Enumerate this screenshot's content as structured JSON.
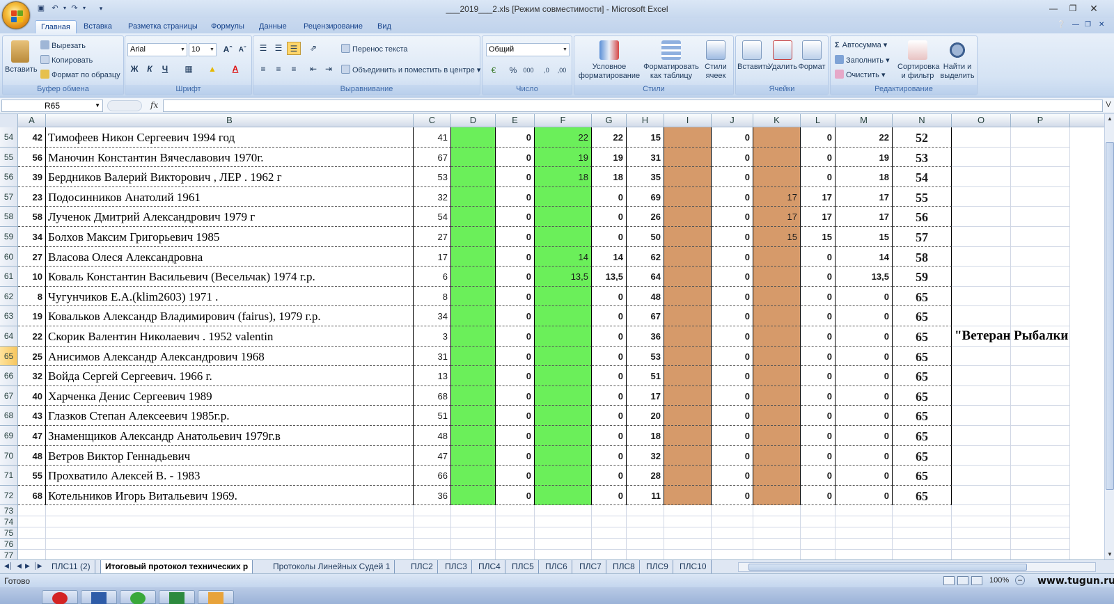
{
  "window": {
    "title": "___2019___2.xls  [Режим совместимости] - Microsoft Excel"
  },
  "tabs": [
    "Главная",
    "Вставка",
    "Разметка страницы",
    "Формулы",
    "Данные",
    "Рецензирование",
    "Вид"
  ],
  "ribbon": {
    "clipboard": {
      "paste": "Вставить",
      "cut": "Вырезать",
      "copy": "Копировать",
      "format_painter": "Формат по образцу",
      "label": "Буфер обмена"
    },
    "font": {
      "name": "Arial",
      "size": "10",
      "bold": "Ж",
      "italic": "К",
      "underline": "Ч",
      "label": "Шрифт"
    },
    "alignment": {
      "wrap": "Перенос текста",
      "merge": "Объединить и поместить в центре",
      "label": "Выравнивание"
    },
    "number": {
      "format": "Общий",
      "percent": "%",
      "thousands": "000",
      "label": "Число"
    },
    "styles": {
      "conditional": "Условное форматирование",
      "as_table": "Форматировать как таблицу",
      "cell_styles": "Стили ячеек",
      "label": "Стили"
    },
    "cells": {
      "insert": "Вставить",
      "delete": "Удалить",
      "format": "Формат",
      "label": "Ячейки"
    },
    "editing": {
      "autosum": "Автосумма",
      "fill": "Заполнить",
      "clear": "Очистить",
      "sort": "Сортировка и фильтр",
      "find": "Найти и выделить",
      "label": "Редактирование"
    }
  },
  "formula_bar": {
    "name_box": "R65",
    "fx": "fx",
    "value": ""
  },
  "columns": [
    "A",
    "B",
    "C",
    "D",
    "E",
    "F",
    "G",
    "H",
    "I",
    "J",
    "K",
    "L",
    "M",
    "N",
    "O",
    "P"
  ],
  "rows": [
    {
      "r": "54",
      "a": "42",
      "b": "Тимофеев Никон Сергеевич 1994 год",
      "c": "41",
      "e": "0",
      "f": "22",
      "g": "22",
      "h": "15",
      "j": "0",
      "k": "",
      "l": "0",
      "m": "22",
      "n": "52"
    },
    {
      "r": "55",
      "a": "56",
      "b": "Маночин Константин Вячеславович 1970г.",
      "c": "67",
      "e": "0",
      "f": "19",
      "g": "19",
      "h": "31",
      "j": "0",
      "k": "",
      "l": "0",
      "m": "19",
      "n": "53"
    },
    {
      "r": "56",
      "a": "39",
      "b": "Бердников Валерий Викторович , ЛЕР . 1962 г",
      "c": "53",
      "e": "0",
      "f": "18",
      "g": "18",
      "h": "35",
      "j": "0",
      "k": "",
      "l": "0",
      "m": "18",
      "n": "54"
    },
    {
      "r": "57",
      "a": "23",
      "b": "Подосинников Анатолий 1961",
      "c": "32",
      "e": "0",
      "f": "",
      "g": "0",
      "h": "69",
      "j": "0",
      "k": "17",
      "l": "17",
      "m": "17",
      "n": "55"
    },
    {
      "r": "58",
      "a": "58",
      "b": "Лученок Дмитрий Александрович 1979 г",
      "c": "54",
      "e": "0",
      "f": "",
      "g": "0",
      "h": "26",
      "j": "0",
      "k": "17",
      "l": "17",
      "m": "17",
      "n": "56"
    },
    {
      "r": "59",
      "a": "34",
      "b": "Болхов Максим Григорьевич 1985",
      "c": "27",
      "e": "0",
      "f": "",
      "g": "0",
      "h": "50",
      "j": "0",
      "k": "15",
      "l": "15",
      "m": "15",
      "n": "57"
    },
    {
      "r": "60",
      "a": "27",
      "b": "Власова Олеся Александровна",
      "c": "17",
      "e": "0",
      "f": "14",
      "g": "14",
      "h": "62",
      "j": "0",
      "k": "",
      "l": "0",
      "m": "14",
      "n": "58"
    },
    {
      "r": "61",
      "a": "10",
      "b": "Коваль Константин Васильевич (Весельчак) 1974 г.р.",
      "c": "6",
      "e": "0",
      "f": "13,5",
      "g": "13,5",
      "h": "64",
      "j": "0",
      "k": "",
      "l": "0",
      "m": "13,5",
      "n": "59"
    },
    {
      "r": "62",
      "a": "8",
      "b": "Чугунчиков Е.А.(klim2603) 1971 .",
      "c": "8",
      "e": "0",
      "f": "",
      "g": "0",
      "h": "48",
      "j": "0",
      "k": "",
      "l": "0",
      "m": "0",
      "n": "65"
    },
    {
      "r": "63",
      "a": "19",
      "b": "Ковальков Александр Владимирович (fairus), 1979 г.р.",
      "c": "34",
      "e": "0",
      "f": "",
      "g": "0",
      "h": "67",
      "j": "0",
      "k": "",
      "l": "0",
      "m": "0",
      "n": "65"
    },
    {
      "r": "64",
      "a": "22",
      "b": "Скорик Валентин Николаевич . 1952 valentin",
      "c": "3",
      "e": "0",
      "f": "",
      "g": "0",
      "h": "36",
      "j": "0",
      "k": "",
      "l": "0",
      "m": "0",
      "n": "65",
      "o": "\"Ветеран Рыбалки"
    },
    {
      "r": "65",
      "a": "25",
      "b": "Анисимов Александр Александрович 1968",
      "c": "31",
      "e": "0",
      "f": "",
      "g": "0",
      "h": "53",
      "j": "0",
      "k": "",
      "l": "0",
      "m": "0",
      "n": "65"
    },
    {
      "r": "66",
      "a": "32",
      "b": "Войда Сергей Сергеевич. 1966 г.",
      "c": "13",
      "e": "0",
      "f": "",
      "g": "0",
      "h": "51",
      "j": "0",
      "k": "",
      "l": "0",
      "m": "0",
      "n": "65"
    },
    {
      "r": "67",
      "a": "40",
      "b": "Харченка Денис Сергеевич 1989",
      "c": "68",
      "e": "0",
      "f": "",
      "g": "0",
      "h": "17",
      "j": "0",
      "k": "",
      "l": "0",
      "m": "0",
      "n": "65"
    },
    {
      "r": "68",
      "a": "43",
      "b": "Глазков Степан Алексеевич 1985г.р.",
      "c": "51",
      "e": "0",
      "f": "",
      "g": "0",
      "h": "20",
      "j": "0",
      "k": "",
      "l": "0",
      "m": "0",
      "n": "65"
    },
    {
      "r": "69",
      "a": "47",
      "b": "Знаменщиков Александр Анатольевич 1979г.в",
      "c": "48",
      "e": "0",
      "f": "",
      "g": "0",
      "h": "18",
      "j": "0",
      "k": "",
      "l": "0",
      "m": "0",
      "n": "65"
    },
    {
      "r": "70",
      "a": "48",
      "b": "Ветров Виктор Геннадьевич",
      "c": "47",
      "e": "0",
      "f": "",
      "g": "0",
      "h": "32",
      "j": "0",
      "k": "",
      "l": "0",
      "m": "0",
      "n": "65"
    },
    {
      "r": "71",
      "a": "55",
      "b": "Прохватило Алексей В. - 1983",
      "c": "66",
      "e": "0",
      "f": "",
      "g": "0",
      "h": "28",
      "j": "0",
      "k": "",
      "l": "0",
      "m": "0",
      "n": "65"
    },
    {
      "r": "72",
      "a": "68",
      "b": "Котельников Игорь Витальевич 1969.",
      "c": "36",
      "e": "0",
      "f": "",
      "g": "0",
      "h": "11",
      "j": "0",
      "k": "",
      "l": "0",
      "m": "0",
      "n": "65"
    }
  ],
  "empty_rows": [
    "73",
    "74",
    "75",
    "76",
    "77"
  ],
  "selected_row": "65",
  "sheet_tabs": [
    "ПЛС11 (2)",
    "Итоговый протокол технических р",
    "Протоколы Линейных Судей 1",
    "ПЛС2",
    "ПЛС3",
    "ПЛС4",
    "ПЛС5",
    "ПЛС6",
    "ПЛС7",
    "ПЛС8",
    "ПЛС9",
    "ПЛС10"
  ],
  "active_sheet": "Итоговый протокол технических р",
  "status": {
    "text": "Готово",
    "zoom": "100%",
    "watermark": "www.tugun.ru"
  },
  "colors": {
    "green": "#6bef5a",
    "tan": "#d69a6a",
    "selected_row_header": "#f6c55d"
  }
}
